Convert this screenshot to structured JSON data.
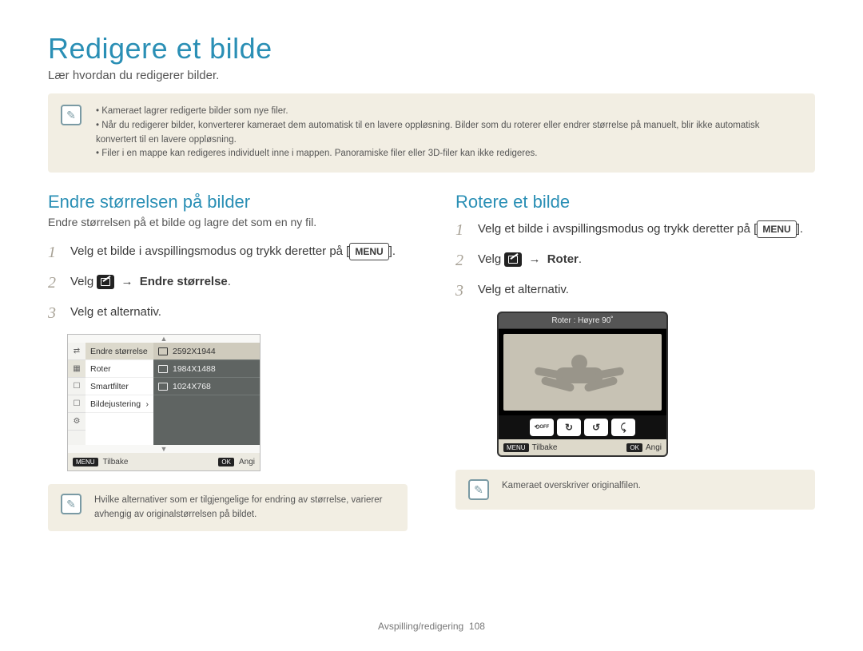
{
  "title": "Redigere et bilde",
  "subtitle": "Lær hvordan du redigerer bilder.",
  "topnotes": [
    "Kameraet lagrer redigerte bilder som nye filer.",
    "Når du redigerer bilder, konverterer kameraet dem automatisk til en lavere oppløsning. Bilder som du roterer eller endrer størrelse på manuelt, blir ikke automatisk konvertert til en lavere oppløsning.",
    "Filer i en mappe kan redigeres individuelt inne i mappen. Panoramiske filer eller 3D-filer kan ikke redigeres."
  ],
  "left": {
    "heading": "Endre størrelsen på bilder",
    "sub": "Endre størrelsen på et bilde og lagre det som en ny fil.",
    "step1a": "Velg et bilde i avspillingsmodus og trykk deretter på [",
    "step1b": "MENU",
    "step1c": "].",
    "step2a": "Velg ",
    "step2arrow": " → ",
    "step2b": "Endre størrelse",
    "step2c": ".",
    "step3": "Velg et alternativ.",
    "menu_items": [
      "Endre størrelse",
      "Roter",
      "Smartfilter",
      "Bildejustering"
    ],
    "opt_items": [
      "2592X1944",
      "1984X1488",
      "1024X768"
    ],
    "foot_back": "Tilbake",
    "foot_set": "Angi",
    "foot_menu": "MENU",
    "foot_ok": "OK",
    "tip": "Hvilke alternativer som er tilgjengelige for endring av størrelse, varierer avhengig av originalstørrelsen på bildet."
  },
  "right": {
    "heading": "Rotere et bilde",
    "step1a": "Velg et bilde i avspillingsmodus og trykk deretter på [",
    "step1b": "MENU",
    "step1c": "].",
    "step2a": "Velg ",
    "step2arrow": " → ",
    "step2b": "Roter",
    "step2c": ".",
    "step3": "Velg et alternativ.",
    "rot_title": "Roter : Høyre 90˚",
    "rot_off": "OFF",
    "foot_back": "Tilbake",
    "foot_set": "Angi",
    "foot_menu": "MENU",
    "foot_ok": "OK",
    "tip": "Kameraet overskriver originalfilen."
  },
  "footer_section": "Avspilling/redigering",
  "footer_page": "108"
}
